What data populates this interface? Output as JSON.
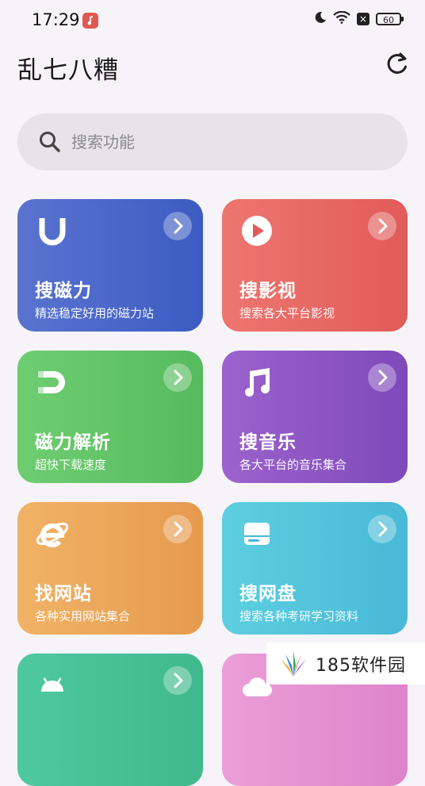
{
  "status_bar": {
    "time": "17:29",
    "battery": "60",
    "icons": [
      "music-app-icon",
      "moon-icon",
      "wifi-icon",
      "close-box-icon",
      "battery-icon"
    ]
  },
  "header": {
    "title": "乱七八糟",
    "refresh_icon": "refresh-icon"
  },
  "search": {
    "placeholder": "搜索功能",
    "icon": "search-icon"
  },
  "cards": [
    {
      "title": "搜磁力",
      "subtitle": "精选稳定好用的磁力站",
      "icon": "magnet-u-icon",
      "color": "#4b67c9"
    },
    {
      "title": "搜影视",
      "subtitle": "搜索各大平台影视",
      "icon": "play-icon",
      "color": "#e7675f"
    },
    {
      "title": "磁力解析",
      "subtitle": "超快下载速度",
      "icon": "magnet-icon",
      "color": "#62c468"
    },
    {
      "title": "搜音乐",
      "subtitle": "各大平台的音乐集合",
      "icon": "music-note-icon",
      "color": "#8d55c3"
    },
    {
      "title": "找网站",
      "subtitle": "各种实用网站集合",
      "icon": "ie-browser-icon",
      "color": "#ecaa5b"
    },
    {
      "title": "搜网盘",
      "subtitle": "搜索各种考研学习资料",
      "icon": "drive-icon",
      "color": "#53c4dc"
    },
    {
      "title": "",
      "subtitle": "",
      "icon": "android-icon",
      "color": "#46c196"
    },
    {
      "title": "",
      "subtitle": "",
      "icon": "cloud-icon",
      "color": "#e491d1"
    }
  ],
  "watermark": {
    "text": "185软件园"
  }
}
